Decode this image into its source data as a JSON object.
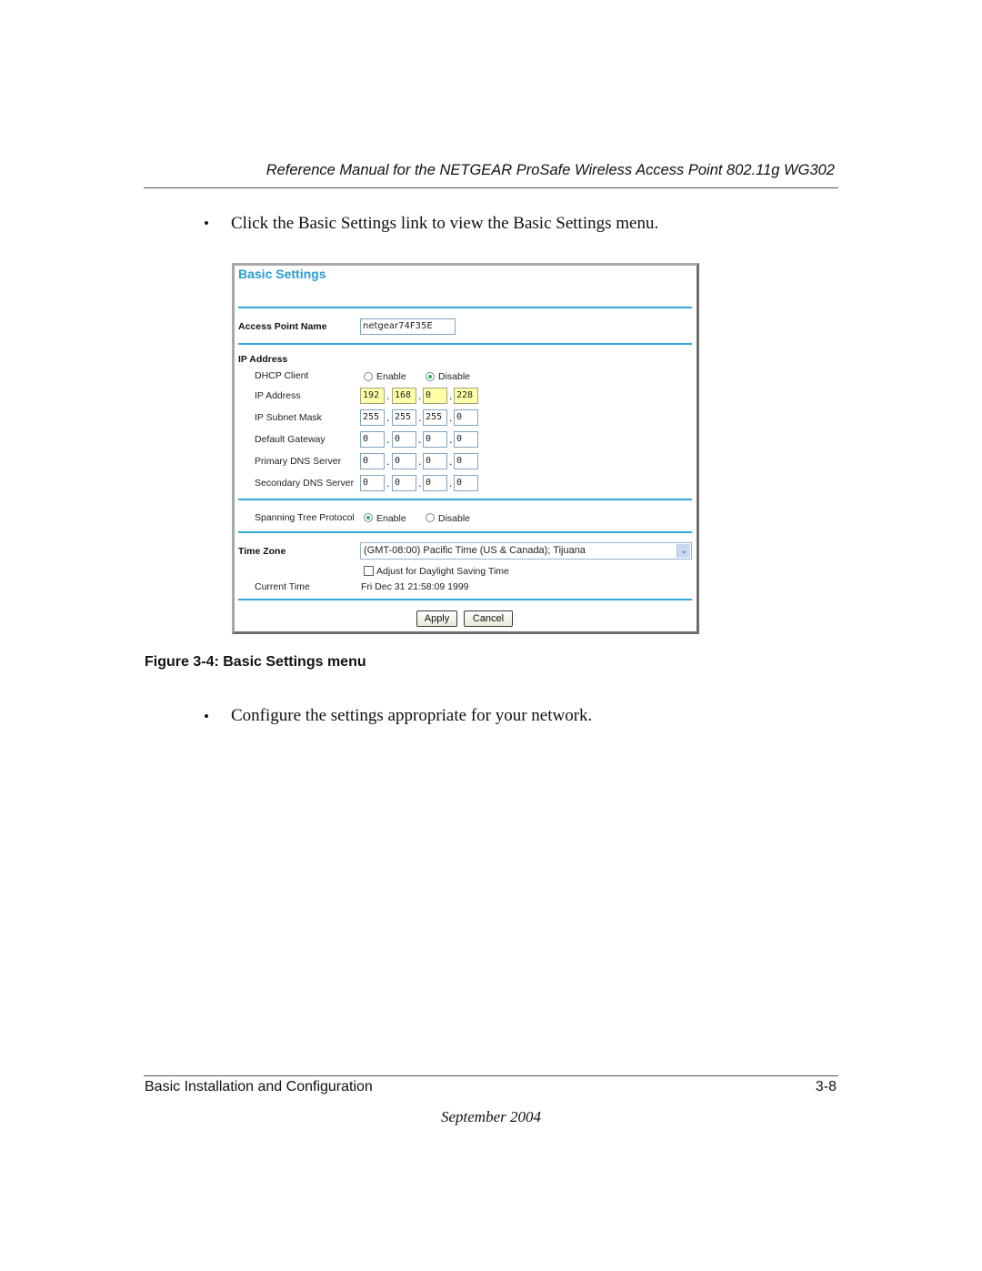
{
  "document": {
    "running_header": "Reference Manual for the NETGEAR ProSafe Wireless Access Point 802.11g WG302",
    "bullets": [
      "Click the Basic Settings link to view the Basic Settings menu.",
      "Configure the settings appropriate for your network."
    ],
    "bullet_glyph": "•",
    "figure_caption": "Figure 3-4: Basic Settings menu",
    "footer": {
      "section": "Basic Installation and Configuration",
      "page": "3-8",
      "date": "September 2004"
    }
  },
  "ui": {
    "title": "Basic Settings",
    "access_point_name": {
      "label": "Access Point Name",
      "value": "netgear74F35E"
    },
    "ip_section_label": "IP Address",
    "dhcp_client": {
      "label": "DHCP Client",
      "options": [
        "Enable",
        "Disable"
      ],
      "selected": "Disable"
    },
    "ip_address": {
      "label": "IP Address",
      "octets": [
        "192",
        "168",
        "0",
        "228"
      ]
    },
    "subnet_mask": {
      "label": "IP Subnet Mask",
      "octets": [
        "255",
        "255",
        "255",
        "0"
      ]
    },
    "default_gateway": {
      "label": "Default Gateway",
      "octets": [
        "0",
        "0",
        "0",
        "0"
      ]
    },
    "primary_dns": {
      "label": "Primary DNS Server",
      "octets": [
        "0",
        "0",
        "0",
        "0"
      ]
    },
    "secondary_dns": {
      "label": "Secondary DNS Server",
      "octets": [
        "0",
        "0",
        "0",
        "0"
      ]
    },
    "octet_separator": ".",
    "spanning_tree": {
      "label": "Spanning Tree Protocol",
      "options": [
        "Enable",
        "Disable"
      ],
      "selected": "Enable"
    },
    "time_zone": {
      "label": "Time Zone",
      "selected": "(GMT-08:00) Pacific Time (US & Canada); Tijuana",
      "arrow": "⌄"
    },
    "daylight_saving": {
      "label": "Adjust for Daylight Saving Time",
      "checked": false
    },
    "current_time": {
      "label": "Current Time",
      "value": "Fri Dec 31 21:58:09 1999"
    },
    "buttons": {
      "apply": "Apply",
      "cancel": "Cancel"
    },
    "colors": {
      "title": "#2a9bd6",
      "rule": "#30a8d8",
      "highlight_field": "#ffffa8",
      "radio_on": "#2fb24b"
    }
  }
}
